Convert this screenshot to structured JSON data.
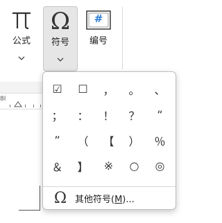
{
  "ribbon": {
    "formula": {
      "label": "公式",
      "icon": "pi-icon",
      "glyph": "π"
    },
    "symbol": {
      "label": "符号",
      "icon": "omega-icon",
      "glyph": "Ω"
    },
    "number": {
      "label": "编号",
      "icon": "number-box-icon",
      "glyph": "#"
    }
  },
  "ruler": {
    "label": "8I"
  },
  "symbols": {
    "items": [
      "☑",
      "☐",
      "，",
      "。",
      "、",
      "；",
      "：",
      "！",
      "？",
      "“",
      "”",
      "（",
      "【",
      "）",
      "％",
      "＆",
      "】",
      "※",
      "○",
      "◎"
    ]
  },
  "more_symbols": {
    "icon": "omega-icon",
    "glyph": "Ω",
    "prefix": "其他符号(",
    "accel": "M",
    "suffix": ")..."
  },
  "colors": {
    "accent": "#2b7cd3",
    "pressed_bg": "#e6e6e6",
    "border": "#bdbdbd"
  }
}
